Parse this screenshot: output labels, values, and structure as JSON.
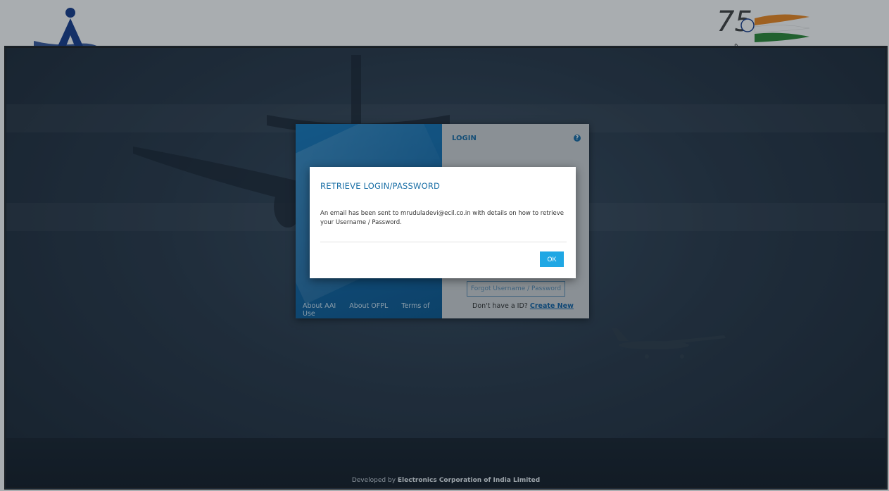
{
  "login": {
    "title": "LOGIN",
    "help_glyph": "?",
    "forgot_label": "Forgot Username / Password",
    "no_id_text": "Don't have a ID?",
    "create_new": "Create New",
    "footer_links": [
      "About AAI",
      "About OFPL",
      "Terms of Use"
    ]
  },
  "modal": {
    "title": "RETRIEVE LOGIN/PASSWORD",
    "body": "An email has been sent to mruduladevi@ecil.co.in with details on how to retrieve your Username / Password.",
    "ok_label": "OK"
  },
  "footer": {
    "prefix": "Developed by",
    "company": "Electronics Corporation of India Limited"
  },
  "colors": {
    "accent": "#1fa7e4",
    "title_blue": "#1a6fa6",
    "panel_blue": "#1468a6"
  },
  "icons": {
    "left_logo": "aai-logo-icon",
    "right_logo": "azadi-75-logo-icon",
    "help": "question-circle-icon"
  }
}
